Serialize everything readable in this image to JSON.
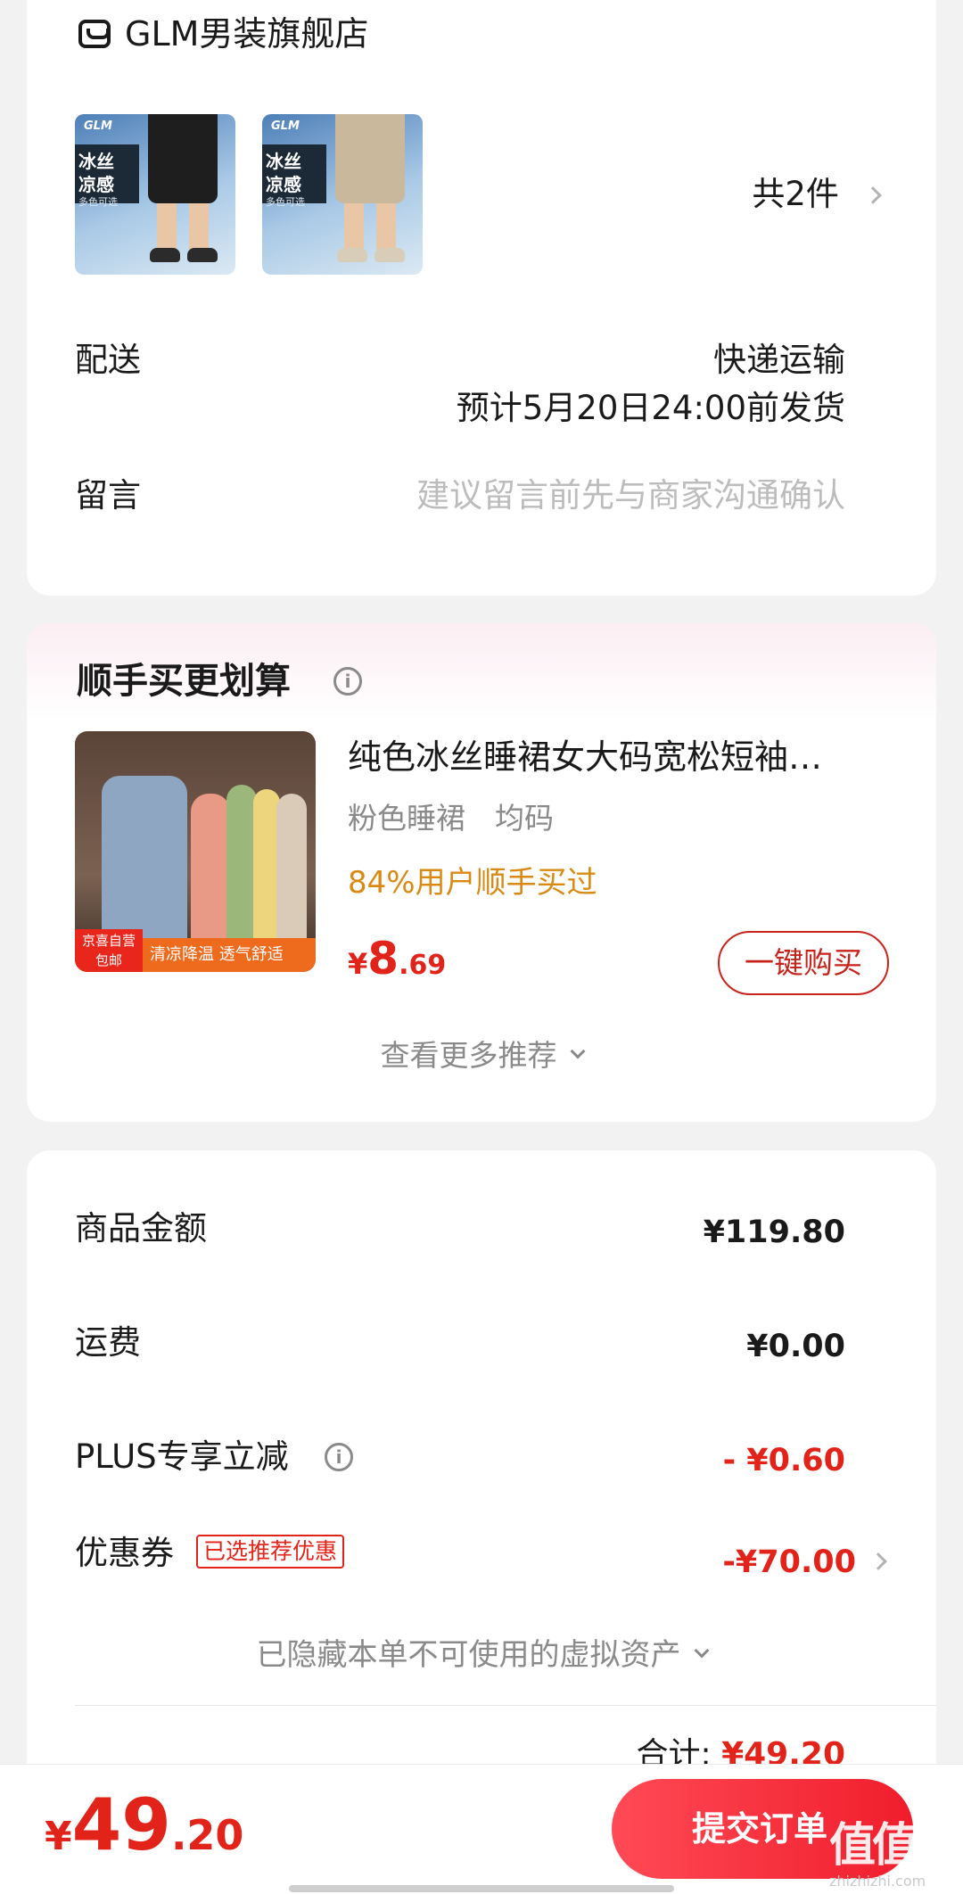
{
  "shop": {
    "name": "GLM男装旗舰店",
    "products": [
      {
        "brand": "GLM",
        "tag_line1": "冰丝",
        "tag_line2": "凉感",
        "tag_sub": "多色可选",
        "color": "#1e1e1e"
      },
      {
        "brand": "GLM",
        "tag_line1": "冰丝",
        "tag_line2": "凉感",
        "tag_sub": "多色可选",
        "color": "#c9b89c"
      }
    ],
    "count_text": "共2件",
    "delivery_label": "配送",
    "delivery_method": "快递运输",
    "delivery_eta": "预计5月20日24:00前发货",
    "message_label": "留言",
    "message_placeholder": "建议留言前先与商家沟通确认"
  },
  "upsell": {
    "title": "顺手买更划算",
    "product_title": "纯色冰丝睡裙女大码宽松短袖…",
    "spec": "粉色睡裙　均码",
    "stat": "84%用户顺手买过",
    "price_symbol": "¥",
    "price_int": "8",
    "price_dec": ".69",
    "buy_button": "一键购买",
    "image_badge_line1": "京喜自营",
    "image_badge_line2": "包邮",
    "image_band": "清凉降温 透气舒适",
    "more": "查看更多推荐"
  },
  "summary": {
    "goods_label": "商品金额",
    "goods_value": "¥119.80",
    "shipping_label": "运费",
    "shipping_value": "¥0.00",
    "plus_label": "PLUS专享立减",
    "plus_value": "- ¥0.60",
    "coupon_label": "优惠券",
    "coupon_tag": "已选推荐优惠",
    "coupon_value": "-¥70.00",
    "hidden_assets": "已隐藏本单不可使用的虚拟资产",
    "total_label": "合计:",
    "total_value": "¥49.20"
  },
  "bottom": {
    "price_symbol": "¥",
    "price_int": "49",
    "price_dec": ".20",
    "submit": "提交订单"
  },
  "watermark": {
    "logo": "值值值",
    "site": "zhizhizhi.com"
  },
  "colors": {
    "accent_red": "#e2231a",
    "stat_orange": "#d98a14",
    "muted_text": "#8a8a8a",
    "placeholder_text": "#bcbcbc"
  }
}
